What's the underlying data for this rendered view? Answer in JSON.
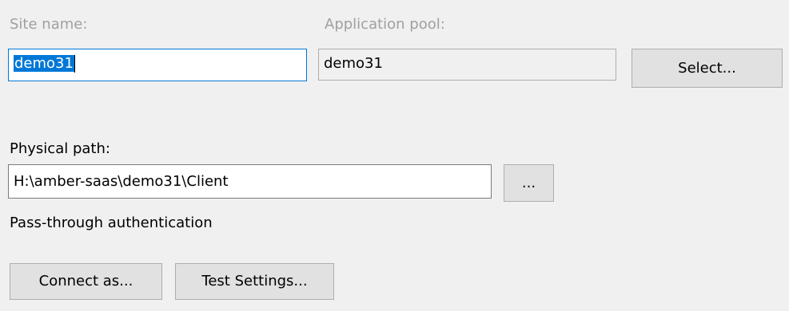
{
  "site_name": {
    "label": "Site name:",
    "value": "demo31"
  },
  "application_pool": {
    "label": "Application pool:",
    "value": "demo31",
    "select_button": "Select..."
  },
  "physical_path": {
    "label": "Physical path:",
    "value": "H:\\amber-saas\\demo31\\Client",
    "browse_button": "..."
  },
  "authentication": {
    "text": "Pass-through authentication"
  },
  "buttons": {
    "connect_as": "Connect as...",
    "test_settings": "Test Settings..."
  },
  "colors": {
    "window_background": "#f0f0f0",
    "selection_highlight": "#0078d7",
    "focus_border": "#0078d7",
    "disabled_text": "#a0a0a0",
    "button_background": "#e1e1e1"
  }
}
